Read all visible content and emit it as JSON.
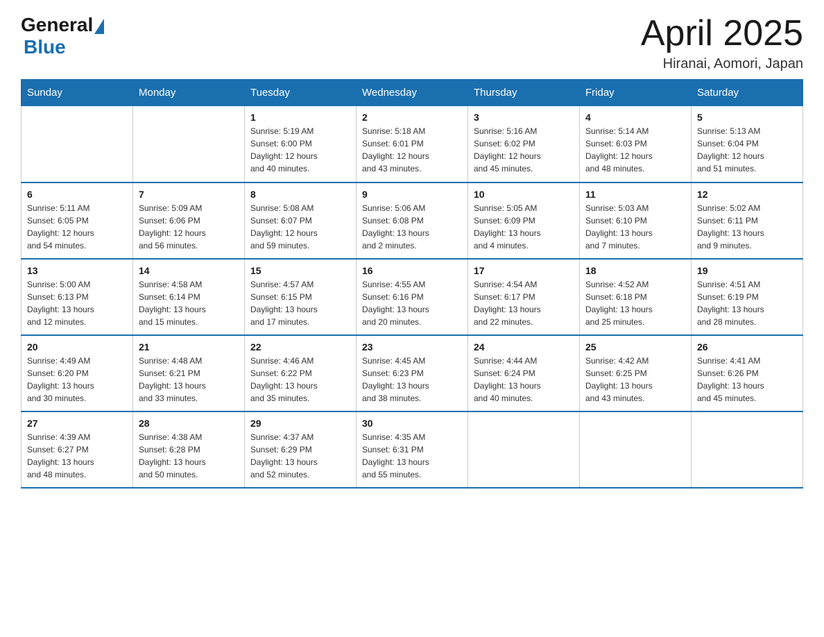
{
  "header": {
    "logo": {
      "part1": "General",
      "part2": "Blue"
    },
    "title": "April 2025",
    "location": "Hiranai, Aomori, Japan"
  },
  "days_of_week": [
    "Sunday",
    "Monday",
    "Tuesday",
    "Wednesday",
    "Thursday",
    "Friday",
    "Saturday"
  ],
  "weeks": [
    [
      {
        "day": "",
        "info": ""
      },
      {
        "day": "",
        "info": ""
      },
      {
        "day": "1",
        "info": "Sunrise: 5:19 AM\nSunset: 6:00 PM\nDaylight: 12 hours\nand 40 minutes."
      },
      {
        "day": "2",
        "info": "Sunrise: 5:18 AM\nSunset: 6:01 PM\nDaylight: 12 hours\nand 43 minutes."
      },
      {
        "day": "3",
        "info": "Sunrise: 5:16 AM\nSunset: 6:02 PM\nDaylight: 12 hours\nand 45 minutes."
      },
      {
        "day": "4",
        "info": "Sunrise: 5:14 AM\nSunset: 6:03 PM\nDaylight: 12 hours\nand 48 minutes."
      },
      {
        "day": "5",
        "info": "Sunrise: 5:13 AM\nSunset: 6:04 PM\nDaylight: 12 hours\nand 51 minutes."
      }
    ],
    [
      {
        "day": "6",
        "info": "Sunrise: 5:11 AM\nSunset: 6:05 PM\nDaylight: 12 hours\nand 54 minutes."
      },
      {
        "day": "7",
        "info": "Sunrise: 5:09 AM\nSunset: 6:06 PM\nDaylight: 12 hours\nand 56 minutes."
      },
      {
        "day": "8",
        "info": "Sunrise: 5:08 AM\nSunset: 6:07 PM\nDaylight: 12 hours\nand 59 minutes."
      },
      {
        "day": "9",
        "info": "Sunrise: 5:06 AM\nSunset: 6:08 PM\nDaylight: 13 hours\nand 2 minutes."
      },
      {
        "day": "10",
        "info": "Sunrise: 5:05 AM\nSunset: 6:09 PM\nDaylight: 13 hours\nand 4 minutes."
      },
      {
        "day": "11",
        "info": "Sunrise: 5:03 AM\nSunset: 6:10 PM\nDaylight: 13 hours\nand 7 minutes."
      },
      {
        "day": "12",
        "info": "Sunrise: 5:02 AM\nSunset: 6:11 PM\nDaylight: 13 hours\nand 9 minutes."
      }
    ],
    [
      {
        "day": "13",
        "info": "Sunrise: 5:00 AM\nSunset: 6:13 PM\nDaylight: 13 hours\nand 12 minutes."
      },
      {
        "day": "14",
        "info": "Sunrise: 4:58 AM\nSunset: 6:14 PM\nDaylight: 13 hours\nand 15 minutes."
      },
      {
        "day": "15",
        "info": "Sunrise: 4:57 AM\nSunset: 6:15 PM\nDaylight: 13 hours\nand 17 minutes."
      },
      {
        "day": "16",
        "info": "Sunrise: 4:55 AM\nSunset: 6:16 PM\nDaylight: 13 hours\nand 20 minutes."
      },
      {
        "day": "17",
        "info": "Sunrise: 4:54 AM\nSunset: 6:17 PM\nDaylight: 13 hours\nand 22 minutes."
      },
      {
        "day": "18",
        "info": "Sunrise: 4:52 AM\nSunset: 6:18 PM\nDaylight: 13 hours\nand 25 minutes."
      },
      {
        "day": "19",
        "info": "Sunrise: 4:51 AM\nSunset: 6:19 PM\nDaylight: 13 hours\nand 28 minutes."
      }
    ],
    [
      {
        "day": "20",
        "info": "Sunrise: 4:49 AM\nSunset: 6:20 PM\nDaylight: 13 hours\nand 30 minutes."
      },
      {
        "day": "21",
        "info": "Sunrise: 4:48 AM\nSunset: 6:21 PM\nDaylight: 13 hours\nand 33 minutes."
      },
      {
        "day": "22",
        "info": "Sunrise: 4:46 AM\nSunset: 6:22 PM\nDaylight: 13 hours\nand 35 minutes."
      },
      {
        "day": "23",
        "info": "Sunrise: 4:45 AM\nSunset: 6:23 PM\nDaylight: 13 hours\nand 38 minutes."
      },
      {
        "day": "24",
        "info": "Sunrise: 4:44 AM\nSunset: 6:24 PM\nDaylight: 13 hours\nand 40 minutes."
      },
      {
        "day": "25",
        "info": "Sunrise: 4:42 AM\nSunset: 6:25 PM\nDaylight: 13 hours\nand 43 minutes."
      },
      {
        "day": "26",
        "info": "Sunrise: 4:41 AM\nSunset: 6:26 PM\nDaylight: 13 hours\nand 45 minutes."
      }
    ],
    [
      {
        "day": "27",
        "info": "Sunrise: 4:39 AM\nSunset: 6:27 PM\nDaylight: 13 hours\nand 48 minutes."
      },
      {
        "day": "28",
        "info": "Sunrise: 4:38 AM\nSunset: 6:28 PM\nDaylight: 13 hours\nand 50 minutes."
      },
      {
        "day": "29",
        "info": "Sunrise: 4:37 AM\nSunset: 6:29 PM\nDaylight: 13 hours\nand 52 minutes."
      },
      {
        "day": "30",
        "info": "Sunrise: 4:35 AM\nSunset: 6:31 PM\nDaylight: 13 hours\nand 55 minutes."
      },
      {
        "day": "",
        "info": ""
      },
      {
        "day": "",
        "info": ""
      },
      {
        "day": "",
        "info": ""
      }
    ]
  ]
}
